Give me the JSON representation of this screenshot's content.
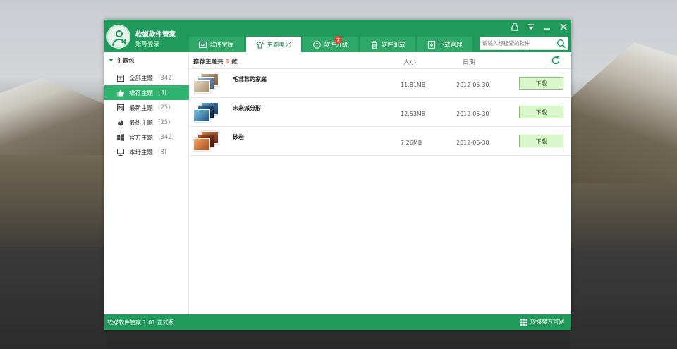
{
  "app": {
    "name": "软媒软件管家",
    "login_label": "账号登录"
  },
  "tabs": [
    {
      "label": "软件宝库",
      "icon": "store-icon",
      "active": false
    },
    {
      "label": "主题美化",
      "icon": "tshirt-icon",
      "active": true
    },
    {
      "label": "软件升级",
      "icon": "upgrade-icon",
      "active": false,
      "badge": "7"
    },
    {
      "label": "软件卸载",
      "icon": "trash-icon",
      "active": false
    },
    {
      "label": "下载管理",
      "icon": "download-icon",
      "active": false
    }
  ],
  "search": {
    "placeholder": "请输入想搜索的软件"
  },
  "window_controls": [
    "skin-icon",
    "menu-icon",
    "minimize-icon",
    "close-icon"
  ],
  "sidebar": {
    "header": "主题包",
    "items": [
      {
        "label": "全部主题",
        "count": "(342)",
        "icon": "all-themes-icon",
        "active": false
      },
      {
        "label": "推荐主题",
        "count": "(3)",
        "icon": "thumbs-up-icon",
        "active": true
      },
      {
        "label": "最新主题",
        "count": "(25)",
        "icon": "new-icon",
        "active": false
      },
      {
        "label": "最热主题",
        "count": "(25)",
        "icon": "flame-icon",
        "active": false
      },
      {
        "label": "官方主题",
        "count": "(342)",
        "icon": "windows-icon",
        "active": false
      },
      {
        "label": "本地主题",
        "count": "(8)",
        "icon": "monitor-icon",
        "active": false
      }
    ]
  },
  "list": {
    "title_prefix": "推荐主题共",
    "title_count": "3",
    "title_suffix": "款",
    "col_size": "大小",
    "col_date": "日期",
    "rows": [
      {
        "name": "毛茸茸的家庭",
        "size": "11.81MB",
        "date": "2012-05-30",
        "action": "下载"
      },
      {
        "name": "未来派分形",
        "size": "12.53MB",
        "date": "2012-05-30",
        "action": "下载"
      },
      {
        "name": "砂岩",
        "size": "7.26MB",
        "date": "2012-05-30",
        "action": "下载"
      }
    ]
  },
  "status": {
    "version": "软媒软件管家 1.01 正式版",
    "site_link": "软媒魔方官网"
  },
  "colors": {
    "brand": "#1f9a5b",
    "active_item": "#2fb36e",
    "download_bg": "#d9f6cd",
    "badge": "#e8402f"
  }
}
